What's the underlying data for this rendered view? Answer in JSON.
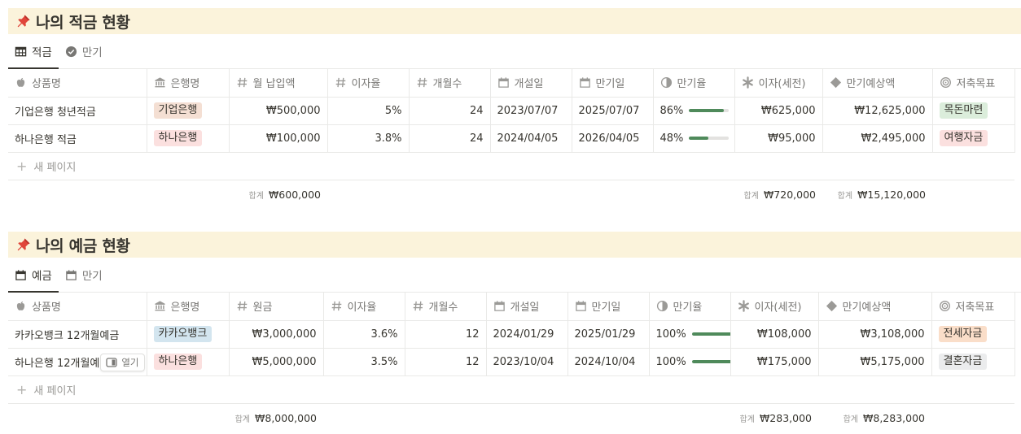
{
  "colors": {
    "callout_bg": "#fbf3db",
    "progress_fill": "#4f8a5b"
  },
  "savings": {
    "title": "나의 적금 현황",
    "tabs": [
      {
        "label": "적금",
        "icon": "table-icon",
        "active": true
      },
      {
        "label": "만기",
        "icon": "check-circle-icon",
        "active": false
      }
    ],
    "columns": [
      "상품명",
      "은행명",
      "월 납입액",
      "이자율",
      "개월수",
      "개설일",
      "만기일",
      "만기율",
      "이자(세전)",
      "만기예상액",
      "저축목표"
    ],
    "rows": [
      {
        "name": "기업은행 청년적금",
        "bank": "기업은행",
        "monthly": "₩500,000",
        "rate": "5%",
        "months": "24",
        "open": "2023/07/07",
        "maturity": "2025/07/07",
        "progress_text": "86%",
        "progress": 0.86,
        "interest": "₩625,000",
        "expected": "₩12,625,000",
        "goal": "목돈마련"
      },
      {
        "name": "하나은행 적금",
        "bank": "하나은행",
        "monthly": "₩100,000",
        "rate": "3.8%",
        "months": "24",
        "open": "2024/04/05",
        "maturity": "2026/04/05",
        "progress_text": "48%",
        "progress": 0.48,
        "interest": "₩95,000",
        "expected": "₩2,495,000",
        "goal": "여행자금"
      }
    ],
    "new_page": "새 페이지",
    "sum_label": "합계",
    "sum_monthly": "₩600,000",
    "sum_interest": "₩720,000",
    "sum_expected": "₩15,120,000"
  },
  "deposits": {
    "title": "나의 예금 현황",
    "tabs": [
      {
        "label": "예금",
        "icon": "calendar-icon",
        "active": true
      },
      {
        "label": "만기",
        "icon": "calendar-icon",
        "active": false
      }
    ],
    "columns": [
      "상품명",
      "은행명",
      "원금",
      "이자율",
      "개월수",
      "개설일",
      "만기일",
      "만기율",
      "이자(세전)",
      "만기예상액",
      "저축목표"
    ],
    "rows": [
      {
        "name": "카카오뱅크 12개월예금",
        "bank": "카카오뱅크",
        "principal": "₩3,000,000",
        "rate": "3.6%",
        "months": "12",
        "open": "2024/01/29",
        "maturity": "2025/01/29",
        "progress_text": "100%",
        "progress": 1.0,
        "interest": "₩108,000",
        "expected": "₩3,108,000",
        "goal": "전세자금"
      },
      {
        "name": "하나은행 12개월예금",
        "bank": "하나은행",
        "principal": "₩5,000,000",
        "rate": "3.5%",
        "months": "12",
        "open": "2023/10/04",
        "maturity": "2024/10/04",
        "progress_text": "100%",
        "progress": 1.0,
        "interest": "₩175,000",
        "expected": "₩5,175,000",
        "goal": "결혼자금"
      }
    ],
    "open_button": "열기",
    "new_page": "새 페이지",
    "sum_label": "합계",
    "sum_principal": "₩8,000,000",
    "sum_interest": "₩283,000",
    "sum_expected": "₩8,283,000"
  }
}
